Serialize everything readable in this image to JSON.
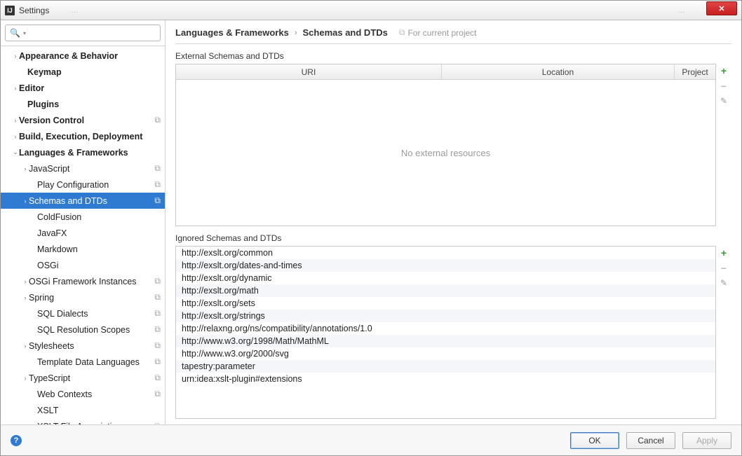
{
  "titlebar": {
    "app_title": "Settings",
    "bg_tab_hint": "…",
    "bg_right_hint": "…"
  },
  "search": {
    "placeholder": ""
  },
  "breadcrumb": {
    "segment1": "Languages & Frameworks",
    "segment2": "Schemas and DTDs",
    "for_project": "For current project"
  },
  "external": {
    "title": "External Schemas and DTDs",
    "columns": {
      "uri": "URI",
      "location": "Location",
      "project": "Project"
    },
    "empty": "No external resources"
  },
  "ignored": {
    "title": "Ignored Schemas and DTDs",
    "items": [
      "http://exslt.org/common",
      "http://exslt.org/dates-and-times",
      "http://exslt.org/dynamic",
      "http://exslt.org/math",
      "http://exslt.org/sets",
      "http://exslt.org/strings",
      "http://relaxng.org/ns/compatibility/annotations/1.0",
      "http://www.w3.org/1998/Math/MathML",
      "http://www.w3.org/2000/svg",
      "tapestry:parameter",
      "urn:idea:xslt-plugin#extensions"
    ]
  },
  "footer": {
    "ok": "OK",
    "cancel": "Cancel",
    "apply": "Apply"
  },
  "sidebar": {
    "items": [
      {
        "label": "Appearance & Behavior",
        "indent": 16,
        "arrow": "›",
        "bold": true
      },
      {
        "label": "Keymap",
        "indent": 28,
        "arrow": "",
        "bold": true
      },
      {
        "label": "Editor",
        "indent": 16,
        "arrow": "›",
        "bold": true
      },
      {
        "label": "Plugins",
        "indent": 28,
        "arrow": "",
        "bold": true
      },
      {
        "label": "Version Control",
        "indent": 16,
        "arrow": "›",
        "bold": true,
        "badge": "⧉"
      },
      {
        "label": "Build, Execution, Deployment",
        "indent": 16,
        "arrow": "›",
        "bold": true
      },
      {
        "label": "Languages & Frameworks",
        "indent": 16,
        "arrow": "⌄",
        "bold": true
      },
      {
        "label": "JavaScript",
        "indent": 30,
        "arrow": "›",
        "badge": "⧉"
      },
      {
        "label": "Play Configuration",
        "indent": 42,
        "arrow": "",
        "badge": "⧉"
      },
      {
        "label": "Schemas and DTDs",
        "indent": 30,
        "arrow": "›",
        "badge": "⧉",
        "selected": true
      },
      {
        "label": "ColdFusion",
        "indent": 42,
        "arrow": ""
      },
      {
        "label": "JavaFX",
        "indent": 42,
        "arrow": ""
      },
      {
        "label": "Markdown",
        "indent": 42,
        "arrow": ""
      },
      {
        "label": "OSGi",
        "indent": 42,
        "arrow": ""
      },
      {
        "label": "OSGi Framework Instances",
        "indent": 30,
        "arrow": "›",
        "badge": "⧉"
      },
      {
        "label": "Spring",
        "indent": 30,
        "arrow": "›",
        "badge": "⧉"
      },
      {
        "label": "SQL Dialects",
        "indent": 42,
        "arrow": "",
        "badge": "⧉"
      },
      {
        "label": "SQL Resolution Scopes",
        "indent": 42,
        "arrow": "",
        "badge": "⧉"
      },
      {
        "label": "Stylesheets",
        "indent": 30,
        "arrow": "›",
        "badge": "⧉"
      },
      {
        "label": "Template Data Languages",
        "indent": 42,
        "arrow": "",
        "badge": "⧉"
      },
      {
        "label": "TypeScript",
        "indent": 30,
        "arrow": "›",
        "badge": "⧉"
      },
      {
        "label": "Web Contexts",
        "indent": 42,
        "arrow": "",
        "badge": "⧉"
      },
      {
        "label": "XSLT",
        "indent": 42,
        "arrow": ""
      },
      {
        "label": "XSLT File Associations",
        "indent": 42,
        "arrow": "",
        "badge": "⧉"
      }
    ]
  }
}
